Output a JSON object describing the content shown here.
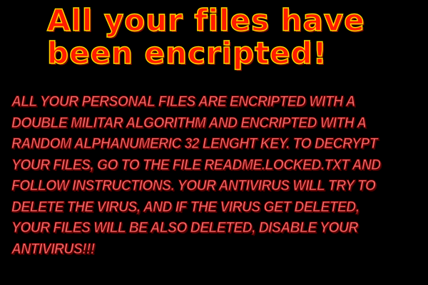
{
  "headline": "All your files have been encripted!",
  "message": " All your personal files are encripted with a double militar algorithm and encripted with a random alphanumeric 32 lenght key. To decrypt your files, go to the file README.LOCKED.txt and follow instructions. Your antivirus will try to delete the virus, and if the virus get deleted, your files will be also deleted, disable your antivirus!!!",
  "colors": {
    "background": "#000000",
    "headline_fill": "#FF1A00",
    "headline_outline": "#FFD600",
    "message_fill": "#F06A6A",
    "message_outline": "#6A0000"
  }
}
